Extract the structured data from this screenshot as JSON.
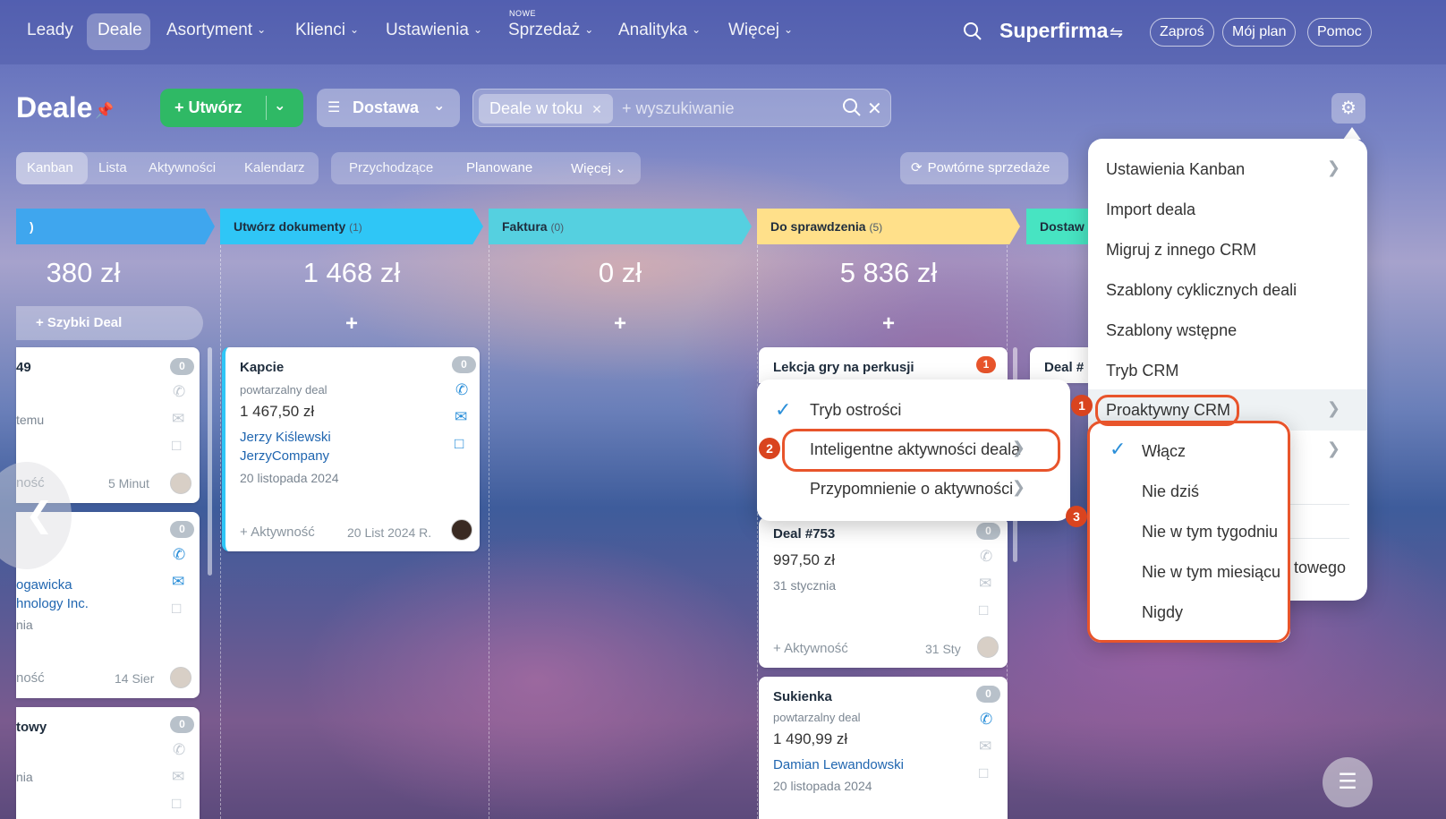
{
  "topnav": {
    "items": [
      "Leady",
      "Deale",
      "Asortyment",
      "Klienci",
      "Ustawienia",
      "Sprzedaż",
      "Analityka",
      "Więcej"
    ],
    "new_badge": "NOWE",
    "brand": "Superfirma",
    "invite": "Zaproś",
    "plan": "Mój plan",
    "help": "Pomoc"
  },
  "toolbar": {
    "title": "Deale",
    "create": "Utwórz",
    "filter": "Dostawa",
    "chip": "Deale w toku",
    "search_placeholder": "+ wyszukiwanie"
  },
  "view_tabs": [
    "Kanban",
    "Lista",
    "Aktywności",
    "Kalendarz"
  ],
  "filter_tabs": [
    "Przychodzące",
    "Planowane",
    "Więcej"
  ],
  "repeat_sales": "Powtórne sprzedaże",
  "columns": [
    {
      "name": "",
      "count": "",
      "sum": "380 zł",
      "color": "#3fa6ee"
    },
    {
      "name": "Utwórz dokumenty",
      "count": "(1)",
      "sum": "1 468 zł",
      "color": "#2fc6f6"
    },
    {
      "name": "Faktura",
      "count": "(0)",
      "sum": "0 zł",
      "color": "#55d0e0"
    },
    {
      "name": "Do sprawdzenia",
      "count": "(5)",
      "sum": "5 836 zł",
      "color": "#ffe08a"
    },
    {
      "name": "Dostaw",
      "count": "",
      "sum": "",
      "color": "#47e4c2"
    }
  ],
  "quick_deal": "+ Szybki Deal",
  "cards": {
    "c1": {
      "title": "49",
      "line": "temu",
      "act": "ność",
      "date": "5 Minut",
      "badge": "0"
    },
    "c2": {
      "company": "ogawicka",
      "company2": "hnology Inc.",
      "line": "nia",
      "act": "ność",
      "date": "14 Sier",
      "badge": "0"
    },
    "c3": {
      "title": "towy",
      "line": "nia",
      "badge": "0"
    },
    "kapcie": {
      "title": "Kapcie",
      "sub": "powtarzalny deal",
      "amount": "1 467,50 zł",
      "contact": "Jerzy Kiślewski",
      "company": "JerzyCompany",
      "date": "20 listopada 2024",
      "act": "+ Aktywność",
      "date_r": "20 List 2024 R.",
      "badge": "0"
    },
    "lekcja": {
      "title": "Lekcja gry na perkusji",
      "badge": "1"
    },
    "deal753": {
      "title": "Deal #753",
      "amount": "997,50 zł",
      "date": "31 stycznia",
      "act": "+ Aktywność",
      "date_r": "31 Sty",
      "badge": "0"
    },
    "sukienka": {
      "title": "Sukienka",
      "sub": "powtarzalny deal",
      "amount": "1 490,99 zł",
      "contact": "Damian Lewandowski",
      "date": "20 listopada 2024",
      "badge": "0"
    },
    "dealhash": {
      "title": "Deal #"
    }
  },
  "settings_menu": {
    "items": [
      "Ustawienia Kanban",
      "Import deala",
      "Migruj z innego CRM",
      "Szablony cyklicznych deali",
      "Szablony wstępne",
      "Tryb CRM",
      "Proaktywny CRM"
    ],
    "partial": "towego"
  },
  "proactive_submenu": [
    "Tryb ostrości",
    "Inteligentne aktywności deala",
    "Przypomnienie o aktywności"
  ],
  "smart_submenu": [
    "Włącz",
    "Nie dziś",
    "Nie w tym tygodniu",
    "Nie w tym miesiącu",
    "Nigdy"
  ],
  "steps": [
    "1",
    "2",
    "3"
  ]
}
